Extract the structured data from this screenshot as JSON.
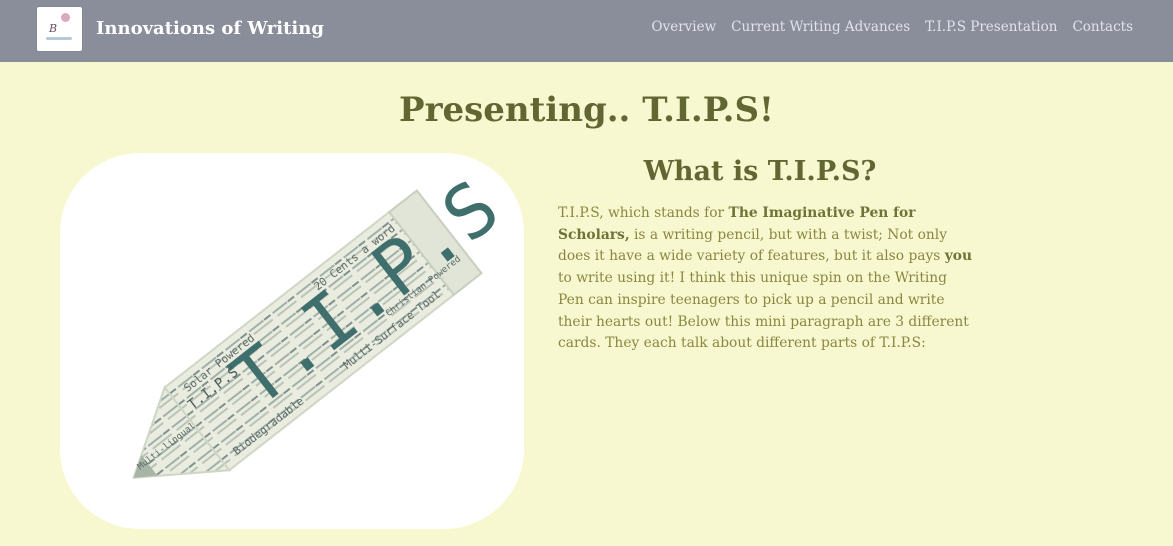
{
  "navbar": {
    "brand": "Innovations of Writing",
    "logo_text": "B",
    "links": [
      "Overview",
      "Current Writing Advances",
      "T.I.P.S Presentation",
      "Contacts"
    ]
  },
  "hero": {
    "title": "Presenting.. T.I.P.S!"
  },
  "image": {
    "big_text": "T.I.P.S",
    "words": [
      "T.I.P.S",
      "Solar Powered",
      "20 Cents a word",
      "Biodegradable",
      "Multi-Surface Tool",
      "Multi-lingual",
      "Christian Powered"
    ]
  },
  "section": {
    "title": "What is T.I.P.S?",
    "p1": "T.I.P.S, which stands for ",
    "p_bold1": "The Imaginative Pen for Scholars,",
    "p2": " is a writing pencil, but with a twist; Not only does it have a wide variety of features, but it also pays ",
    "p_bold2": "you",
    "p3": " to write using it! I think this unique spin on the Writing Pen can inspire teenagers to pick up a pencil and write their hearts out! Below this mini paragraph are 3 different cards. They each talk about different parts of T.I.P.S:"
  },
  "colors": {
    "page_bg": "#f8f8d0",
    "navbar_bg": "#8a8d9a",
    "heading": "#626632",
    "body_text": "#8a8640",
    "accent_teal": "#3f6f6c"
  }
}
